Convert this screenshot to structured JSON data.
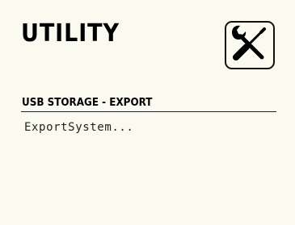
{
  "screen": {
    "title": "UTILITY",
    "icon": "tools-icon",
    "section_header": "USB STORAGE - EXPORT",
    "status_text": "ExportSystem..."
  },
  "colors": {
    "background": "#fbfaf0",
    "foreground": "#000000"
  }
}
